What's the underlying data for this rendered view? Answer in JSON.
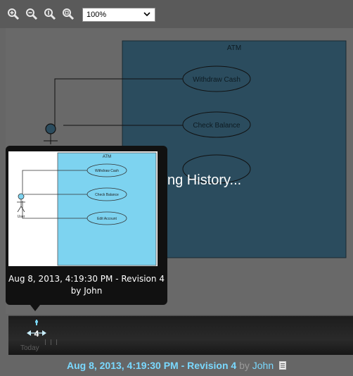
{
  "toolbar": {
    "icons": [
      "zoom-in-icon",
      "zoom-out-icon",
      "zoom-actual-icon",
      "zoom-fit-icon"
    ],
    "zoom_value": "100%"
  },
  "diagram": {
    "boundary_title": "ATM",
    "use_cases": [
      "Withdraw Cash",
      "Check Balance"
    ],
    "loading_text": "ng History..."
  },
  "popup": {
    "thumbnail": {
      "boundary_title": "ATM",
      "actor": "User",
      "use_cases": [
        "Withdraw Cash",
        "Check Balance",
        "Edit Account"
      ]
    },
    "caption_line1": "Aug 8, 2013, 4:19:30 PM - Revision 4",
    "caption_line2": "by John"
  },
  "timeline": {
    "revision_number": "4",
    "today_label": "Today"
  },
  "status": {
    "revision_text": "Aug 8, 2013, 4:19:30 PM - Revision 4",
    "by_text": "by",
    "author": "John"
  },
  "colors": {
    "canvas_bg": "#696969",
    "boundary_fill": "#2b4c5e",
    "thumb_boundary_fill": "#7dd3f0",
    "accent": "#7ad9ff"
  }
}
